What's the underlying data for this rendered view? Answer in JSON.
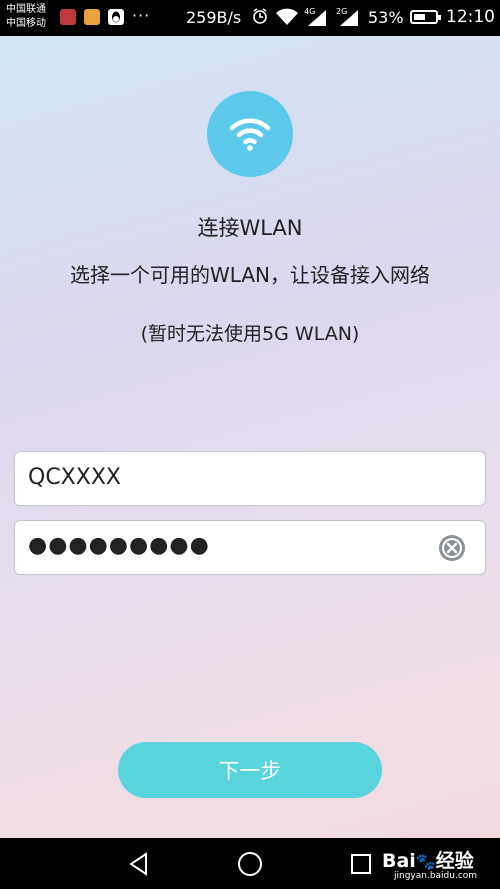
{
  "status_bar": {
    "carrier_1": "中国联通",
    "carrier_2": "中国移动",
    "dots": "···",
    "net_speed": "259B/s",
    "net_type_1": "4G",
    "net_type_2": "2G",
    "battery_percent": "53%",
    "battery_level": 0.53,
    "time": "12:10"
  },
  "page": {
    "title": "连接WLAN",
    "subtitle": "选择一个可用的WLAN，让设备接入网络",
    "note": "(暂时无法使用5G WLAN)"
  },
  "form": {
    "ssid_value": "QCXXXX",
    "password_masked": "●●●●●●●●●"
  },
  "actions": {
    "next_label": "下一步"
  },
  "watermark": {
    "brand": "Bai",
    "brand_suffix": "经验",
    "url": "jingyan.baidu.com"
  },
  "colors": {
    "accent": "#5cc9ea",
    "button": "#59d4dc"
  }
}
